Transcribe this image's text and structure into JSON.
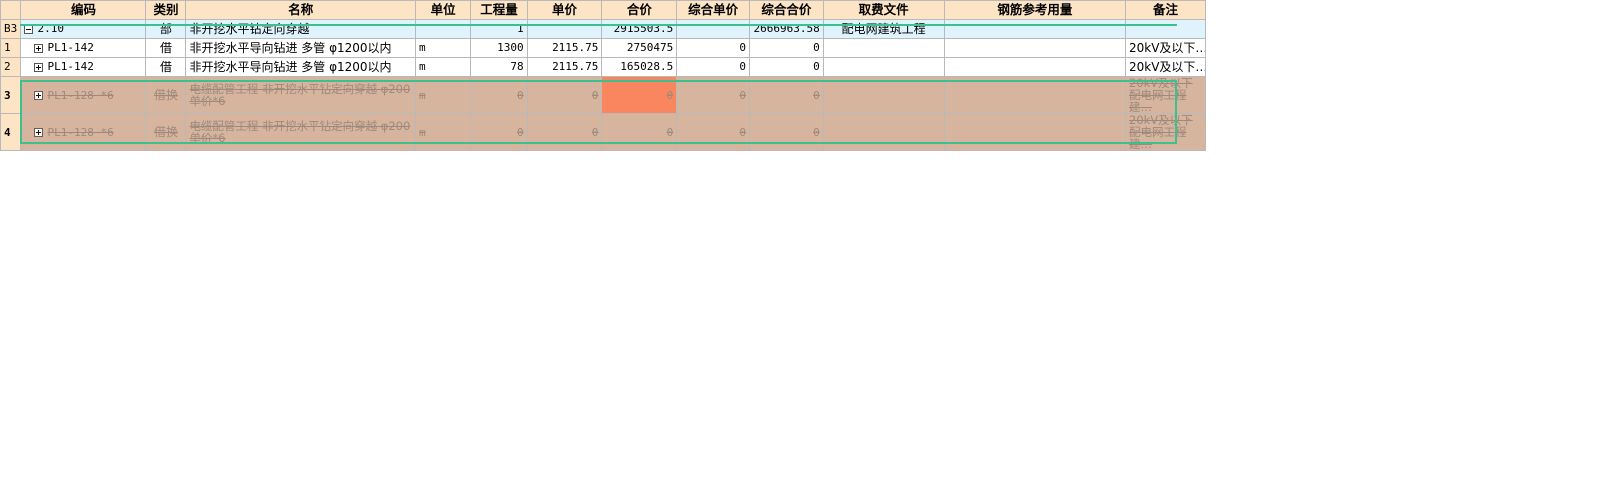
{
  "headers": [
    "编码",
    "类别",
    "名称",
    "单位",
    "工程量",
    "单价",
    "合价",
    "综合单价",
    "综合合价",
    "取费文件",
    "钢筋参考用量",
    "备注"
  ],
  "rows": [
    {
      "rn": "B3",
      "code": "2.10",
      "type": "部",
      "name": "非开挖水平钻定向穿越",
      "unit": "",
      "qty": "1",
      "price": "",
      "total": "2915503.5",
      "cprice": "",
      "ctotal": "2666963.58",
      "fee": "配电网建筑工程",
      "steel": "",
      "note": ""
    },
    {
      "rn": "1",
      "code": "PL1-142",
      "type": "借",
      "name": "非开挖水平导向钻进 多管 φ1200以内",
      "unit": "m",
      "qty": "1300",
      "price": "2115.75",
      "total": "2750475",
      "cprice": "0",
      "ctotal": "0",
      "fee": "",
      "steel": "",
      "note": "20kV及以下…"
    },
    {
      "rn": "2",
      "code": "PL1-142",
      "type": "借",
      "name": "非开挖水平导向钻进 多管 φ1200以内",
      "unit": "m",
      "qty": "78",
      "price": "2115.75",
      "total": "165028.5",
      "cprice": "0",
      "ctotal": "0",
      "fee": "",
      "steel": "",
      "note": "20kV及以下…"
    },
    {
      "rn": "3",
      "code": "PL1-128 *6",
      "type": "借换",
      "name": "电缆配管工程 非开挖水平钻定向穿越 φ200 单价*6",
      "unit": "m",
      "qty": "0",
      "price": "0",
      "total": "0",
      "cprice": "0",
      "ctotal": "0",
      "fee": "",
      "steel": "",
      "note": "20kV及以下配电网工程建…"
    },
    {
      "rn": "4",
      "code": "PL1-128 *6",
      "type": "借换",
      "name": "电缆配管工程 非开挖水平钻定向穿越 φ200 单价*6",
      "unit": "m",
      "qty": "0",
      "price": "0",
      "total": "0",
      "cprice": "0",
      "ctotal": "0",
      "fee": "",
      "steel": "",
      "note": "20kV及以下配电网工程建…"
    }
  ],
  "colors": {
    "header": "#fde4c4",
    "section": "#def3fb",
    "disabled": "#d7b49e",
    "highlight": "#fa8660",
    "selection": "#3cc18e"
  }
}
